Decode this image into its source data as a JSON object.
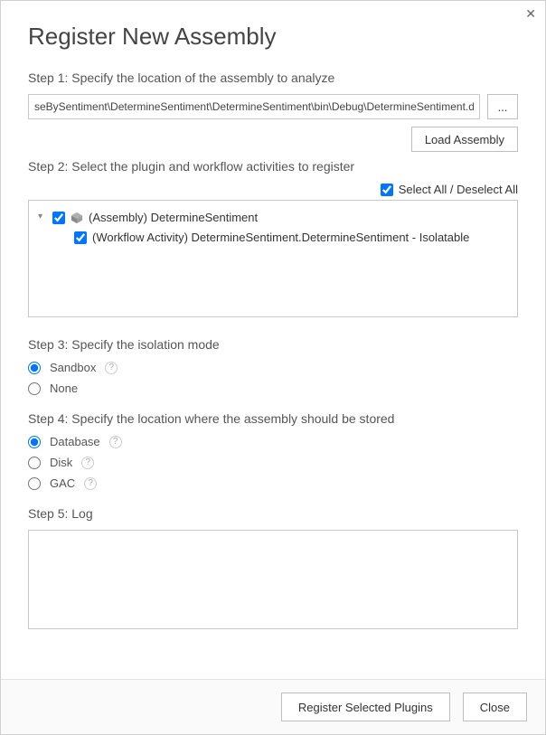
{
  "title": "Register New Assembly",
  "step1": {
    "label": "Step 1: Specify the location of the assembly to analyze",
    "path_value": "seBySentiment\\DetermineSentiment\\DetermineSentiment\\bin\\Debug\\DetermineSentiment.dll",
    "browse_label": "...",
    "load_label": "Load Assembly"
  },
  "step2": {
    "label": "Step 2: Select the plugin and workflow activities to register",
    "select_all_label": "Select All / Deselect All",
    "select_all_checked": true,
    "tree": {
      "assembly_checked": true,
      "assembly_label": "(Assembly) DetermineSentiment",
      "activity_checked": true,
      "activity_label": "(Workflow Activity) DetermineSentiment.DetermineSentiment - Isolatable"
    }
  },
  "step3": {
    "label": "Step 3: Specify the isolation mode",
    "options": {
      "sandbox": "Sandbox",
      "none": "None"
    },
    "selected": "sandbox"
  },
  "step4": {
    "label": "Step 4: Specify the location where the assembly should be stored",
    "options": {
      "database": "Database",
      "disk": "Disk",
      "gac": "GAC"
    },
    "selected": "database"
  },
  "step5": {
    "label": "Step 5: Log"
  },
  "footer": {
    "register_label": "Register Selected Plugins",
    "close_label": "Close"
  }
}
